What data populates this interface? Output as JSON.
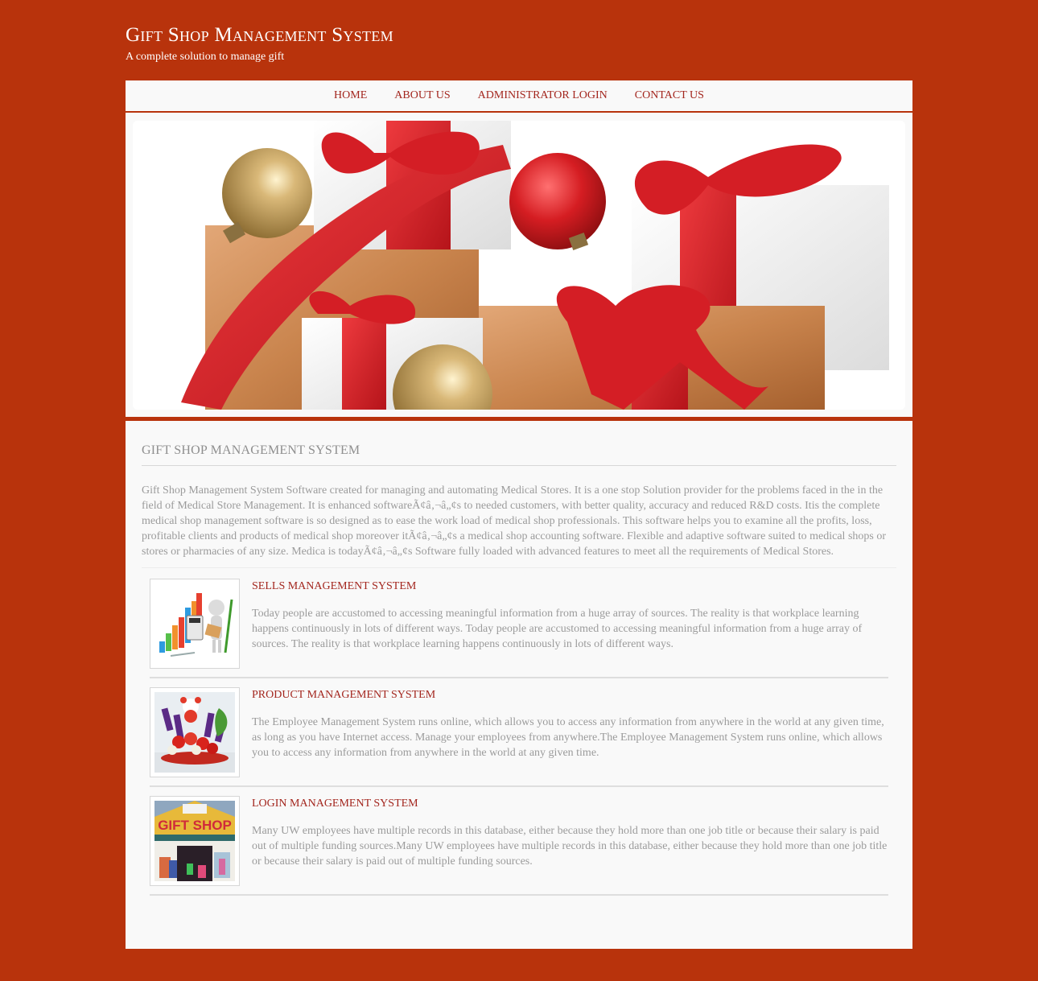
{
  "header": {
    "title": "Gift Shop Management System",
    "tagline": "A complete solution to manage gift"
  },
  "nav": {
    "items": [
      {
        "label": "HOME"
      },
      {
        "label": "ABOUT US"
      },
      {
        "label": "ADMINISTRATOR LOGIN"
      },
      {
        "label": "CONTACT US"
      }
    ]
  },
  "banner": {
    "image": "wrapped-gifts-with-red-ribbons-and-ornaments"
  },
  "main": {
    "section_title": "GIFT SHOP MANAGEMENT SYSTEM",
    "intro": "Gift Shop Management System Software created for managing and automating Medical Stores. It is a one stop Solution provider for the problems faced in the in the field of Medical Store Management. It is enhanced softwareÃ¢â‚¬â„¢s to needed customers, with better quality, accuracy and reduced R&D costs. Itis the complete medical shop management software is so designed as to ease the work load of medical shop professionals. This software helps you to examine all the profits, loss, profitable clients and products of medical shop moreover itÃ¢â‚¬â„¢s a medical shop accounting software. Flexible and adaptive software suited to medical shops or stores or pharmacies of any size. Medica is todayÃ¢â‚¬â„¢s Software fully loaded with advanced features to meet all the requirements of Medical Stores.",
    "features": [
      {
        "title": "SELLS MANAGEMENT SYSTEM",
        "image": "sales-chart-figure",
        "text": "Today people are accustomed to accessing meaningful information from a huge array of sources. The reality is that workplace learning happens continuously in lots of different ways. Today people are accustomed to accessing meaningful information from a huge array of sources. The reality is that workplace learning happens continuously in lots of different ways."
      },
      {
        "title": "PRODUCT MANAGEMENT SYSTEM",
        "image": "teddy-bear-gift-basket",
        "text": "The Employee Management System runs online, which allows you to access any information from anywhere in the world at any given time, as long as you have Internet access. Manage your employees from anywhere.The Employee Management System runs online, which allows you to access any information from anywhere in the world at any given time."
      },
      {
        "title": "LOGIN MANAGEMENT SYSTEM",
        "image": "gift-shop-storefront",
        "sign": "GIFT SHOP",
        "text": "Many UW employees have multiple records in this database, either because they hold more than one job title or because their salary is paid out of multiple funding sources.Many UW employees have multiple records in this database, either because they hold more than one job title or because their salary is paid out of multiple funding sources."
      }
    ]
  },
  "colors": {
    "brand": "#b8330c",
    "link": "#a3261e",
    "body_text": "#9b9b9b",
    "panel": "#f9f9f9"
  }
}
